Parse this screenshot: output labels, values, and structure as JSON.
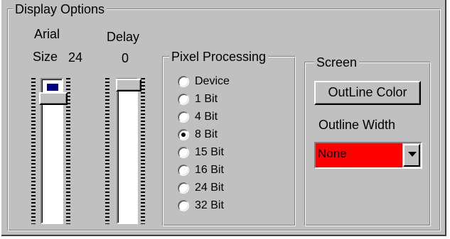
{
  "display_options": {
    "title": "Display Options",
    "font_name": "Arial",
    "size_label": "Size",
    "size_value": "24",
    "delay_label": "Delay",
    "delay_value": "0"
  },
  "pixel_processing": {
    "title": "Pixel Processing",
    "options": [
      "Device",
      "1 Bit",
      "4 Bit",
      "8 Bit",
      "15 Bit",
      "16 Bit",
      "24 Bit",
      "32 Bit"
    ],
    "selected": "8 Bit"
  },
  "screen": {
    "title": "Screen",
    "outline_color_button": "OutLine Color",
    "outline_width_label": "Outline Width",
    "outline_width_value": "None",
    "outline_width_color": "#ff0000"
  },
  "colors": {
    "face": "#c0c0c0",
    "selection": "#000080"
  }
}
